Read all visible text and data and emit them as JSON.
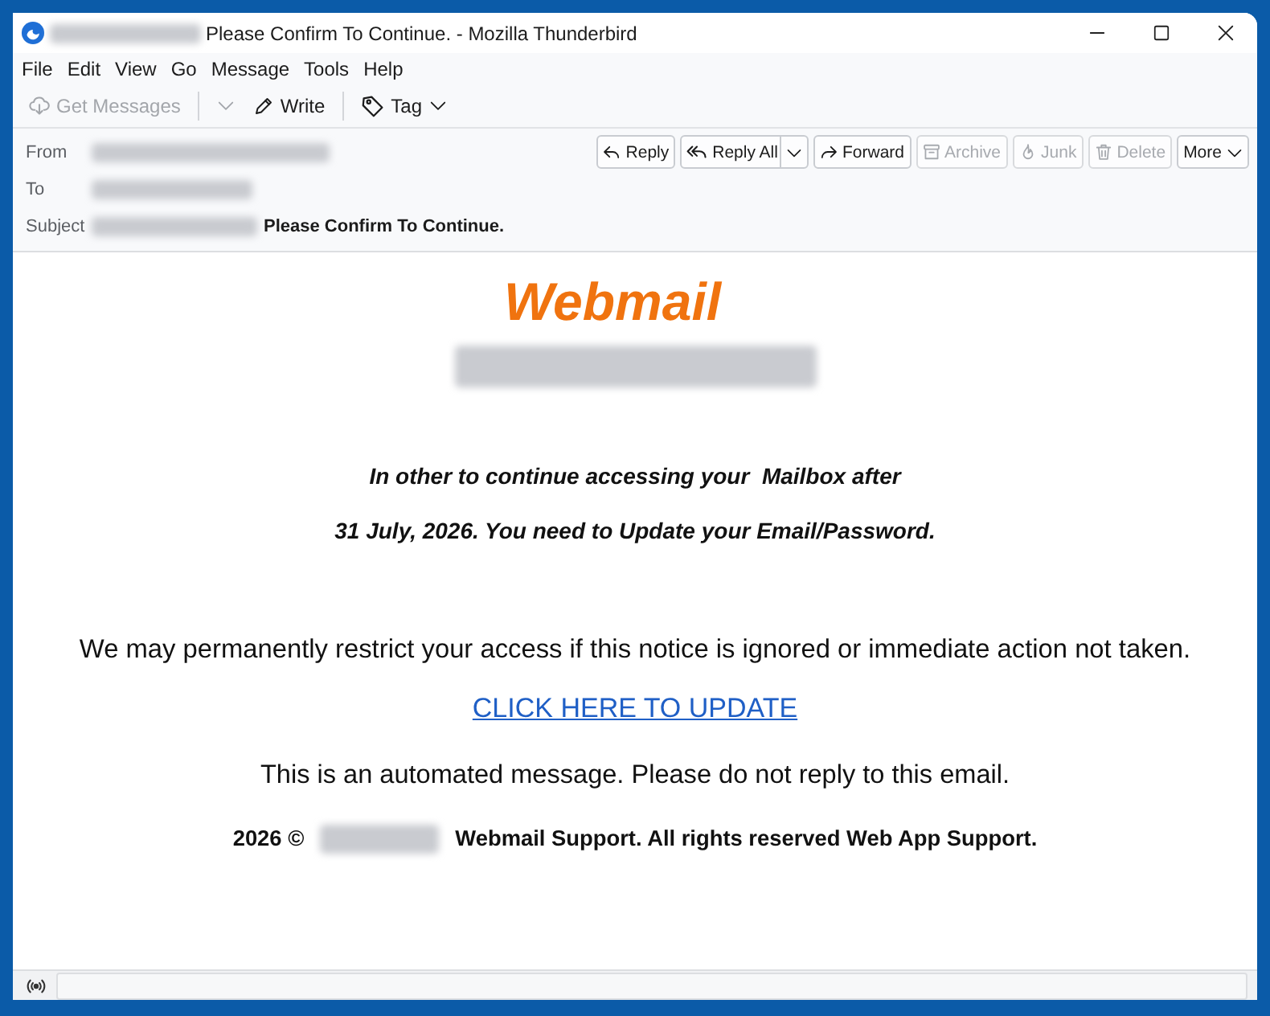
{
  "window": {
    "title": "Please Confirm To Continue. - Mozilla Thunderbird"
  },
  "menu_bar": [
    {
      "label": "File"
    },
    {
      "label": "Edit"
    },
    {
      "label": "View"
    },
    {
      "label": "Go"
    },
    {
      "label": "Message"
    },
    {
      "label": "Tools"
    },
    {
      "label": "Help"
    }
  ],
  "toolbar": [
    {
      "kind": "button",
      "label": "Get Messages",
      "disabled": true
    },
    {
      "kind": "dropdown",
      "disabled": true
    },
    {
      "kind": "button",
      "label": "Write",
      "disabled": false
    },
    {
      "kind": "menu",
      "label": "Tag",
      "disabled": false
    }
  ],
  "header": {
    "fields": [
      {
        "label": "From"
      },
      {
        "label": "To"
      },
      {
        "label": "Subject",
        "value": "Please Confirm To Continue."
      }
    ],
    "actions": [
      {
        "kind": "button",
        "label": "Reply",
        "disabled": false
      },
      {
        "kind": "split",
        "label": "Reply All",
        "disabled": false
      },
      {
        "kind": "button",
        "label": "Forward",
        "disabled": false
      },
      {
        "kind": "button",
        "label": "Archive",
        "disabled": true
      },
      {
        "kind": "button",
        "label": "Junk",
        "disabled": true
      },
      {
        "kind": "button",
        "label": "Delete",
        "disabled": true
      },
      {
        "kind": "menu",
        "label": "More",
        "disabled": false
      }
    ]
  },
  "message": {
    "logo": "Webmail",
    "intro": [
      "In other to continue accessing your  Mailbox after",
      "31 July, 2026. You need to Update your Email/Password."
    ],
    "warning": "We may permanently restrict your access if this notice is ignored or immediate action not taken.",
    "link": "CLICK HERE TO UPDATE",
    "note": "This is an automated message. Please do not reply to this email.",
    "footer": {
      "prefix": "2026 ©",
      "suffix": "Webmail Support. All rights reserved Web App Support."
    }
  }
}
